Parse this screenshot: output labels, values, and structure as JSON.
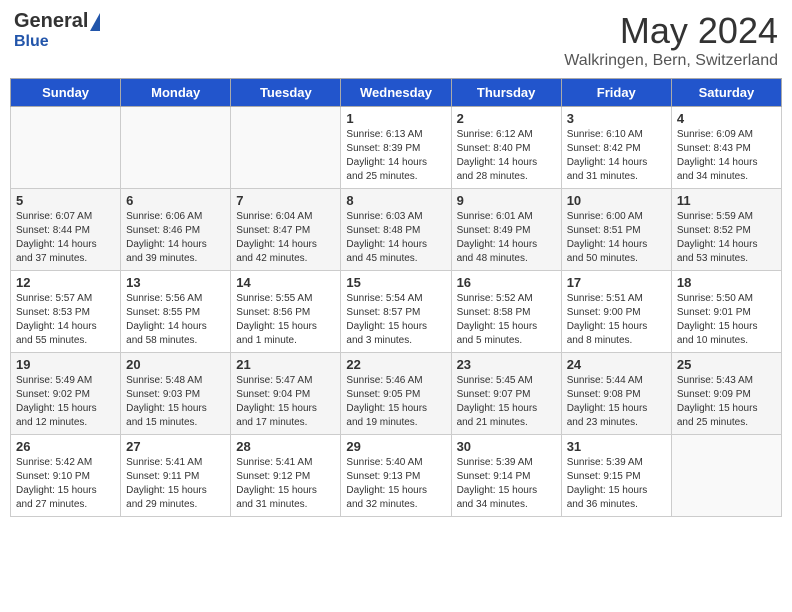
{
  "app": {
    "name_general": "General",
    "name_blue": "Blue"
  },
  "header": {
    "title": "May 2024",
    "location": "Walkringen, Bern, Switzerland"
  },
  "calendar": {
    "days_of_week": [
      "Sunday",
      "Monday",
      "Tuesday",
      "Wednesday",
      "Thursday",
      "Friday",
      "Saturday"
    ],
    "weeks": [
      [
        {
          "day": "",
          "info": ""
        },
        {
          "day": "",
          "info": ""
        },
        {
          "day": "",
          "info": ""
        },
        {
          "day": "1",
          "info": "Sunrise: 6:13 AM\nSunset: 8:39 PM\nDaylight: 14 hours\nand 25 minutes."
        },
        {
          "day": "2",
          "info": "Sunrise: 6:12 AM\nSunset: 8:40 PM\nDaylight: 14 hours\nand 28 minutes."
        },
        {
          "day": "3",
          "info": "Sunrise: 6:10 AM\nSunset: 8:42 PM\nDaylight: 14 hours\nand 31 minutes."
        },
        {
          "day": "4",
          "info": "Sunrise: 6:09 AM\nSunset: 8:43 PM\nDaylight: 14 hours\nand 34 minutes."
        }
      ],
      [
        {
          "day": "5",
          "info": "Sunrise: 6:07 AM\nSunset: 8:44 PM\nDaylight: 14 hours\nand 37 minutes."
        },
        {
          "day": "6",
          "info": "Sunrise: 6:06 AM\nSunset: 8:46 PM\nDaylight: 14 hours\nand 39 minutes."
        },
        {
          "day": "7",
          "info": "Sunrise: 6:04 AM\nSunset: 8:47 PM\nDaylight: 14 hours\nand 42 minutes."
        },
        {
          "day": "8",
          "info": "Sunrise: 6:03 AM\nSunset: 8:48 PM\nDaylight: 14 hours\nand 45 minutes."
        },
        {
          "day": "9",
          "info": "Sunrise: 6:01 AM\nSunset: 8:49 PM\nDaylight: 14 hours\nand 48 minutes."
        },
        {
          "day": "10",
          "info": "Sunrise: 6:00 AM\nSunset: 8:51 PM\nDaylight: 14 hours\nand 50 minutes."
        },
        {
          "day": "11",
          "info": "Sunrise: 5:59 AM\nSunset: 8:52 PM\nDaylight: 14 hours\nand 53 minutes."
        }
      ],
      [
        {
          "day": "12",
          "info": "Sunrise: 5:57 AM\nSunset: 8:53 PM\nDaylight: 14 hours\nand 55 minutes."
        },
        {
          "day": "13",
          "info": "Sunrise: 5:56 AM\nSunset: 8:55 PM\nDaylight: 14 hours\nand 58 minutes."
        },
        {
          "day": "14",
          "info": "Sunrise: 5:55 AM\nSunset: 8:56 PM\nDaylight: 15 hours\nand 1 minute."
        },
        {
          "day": "15",
          "info": "Sunrise: 5:54 AM\nSunset: 8:57 PM\nDaylight: 15 hours\nand 3 minutes."
        },
        {
          "day": "16",
          "info": "Sunrise: 5:52 AM\nSunset: 8:58 PM\nDaylight: 15 hours\nand 5 minutes."
        },
        {
          "day": "17",
          "info": "Sunrise: 5:51 AM\nSunset: 9:00 PM\nDaylight: 15 hours\nand 8 minutes."
        },
        {
          "day": "18",
          "info": "Sunrise: 5:50 AM\nSunset: 9:01 PM\nDaylight: 15 hours\nand 10 minutes."
        }
      ],
      [
        {
          "day": "19",
          "info": "Sunrise: 5:49 AM\nSunset: 9:02 PM\nDaylight: 15 hours\nand 12 minutes."
        },
        {
          "day": "20",
          "info": "Sunrise: 5:48 AM\nSunset: 9:03 PM\nDaylight: 15 hours\nand 15 minutes."
        },
        {
          "day": "21",
          "info": "Sunrise: 5:47 AM\nSunset: 9:04 PM\nDaylight: 15 hours\nand 17 minutes."
        },
        {
          "day": "22",
          "info": "Sunrise: 5:46 AM\nSunset: 9:05 PM\nDaylight: 15 hours\nand 19 minutes."
        },
        {
          "day": "23",
          "info": "Sunrise: 5:45 AM\nSunset: 9:07 PM\nDaylight: 15 hours\nand 21 minutes."
        },
        {
          "day": "24",
          "info": "Sunrise: 5:44 AM\nSunset: 9:08 PM\nDaylight: 15 hours\nand 23 minutes."
        },
        {
          "day": "25",
          "info": "Sunrise: 5:43 AM\nSunset: 9:09 PM\nDaylight: 15 hours\nand 25 minutes."
        }
      ],
      [
        {
          "day": "26",
          "info": "Sunrise: 5:42 AM\nSunset: 9:10 PM\nDaylight: 15 hours\nand 27 minutes."
        },
        {
          "day": "27",
          "info": "Sunrise: 5:41 AM\nSunset: 9:11 PM\nDaylight: 15 hours\nand 29 minutes."
        },
        {
          "day": "28",
          "info": "Sunrise: 5:41 AM\nSunset: 9:12 PM\nDaylight: 15 hours\nand 31 minutes."
        },
        {
          "day": "29",
          "info": "Sunrise: 5:40 AM\nSunset: 9:13 PM\nDaylight: 15 hours\nand 32 minutes."
        },
        {
          "day": "30",
          "info": "Sunrise: 5:39 AM\nSunset: 9:14 PM\nDaylight: 15 hours\nand 34 minutes."
        },
        {
          "day": "31",
          "info": "Sunrise: 5:39 AM\nSunset: 9:15 PM\nDaylight: 15 hours\nand 36 minutes."
        },
        {
          "day": "",
          "info": ""
        }
      ]
    ]
  }
}
